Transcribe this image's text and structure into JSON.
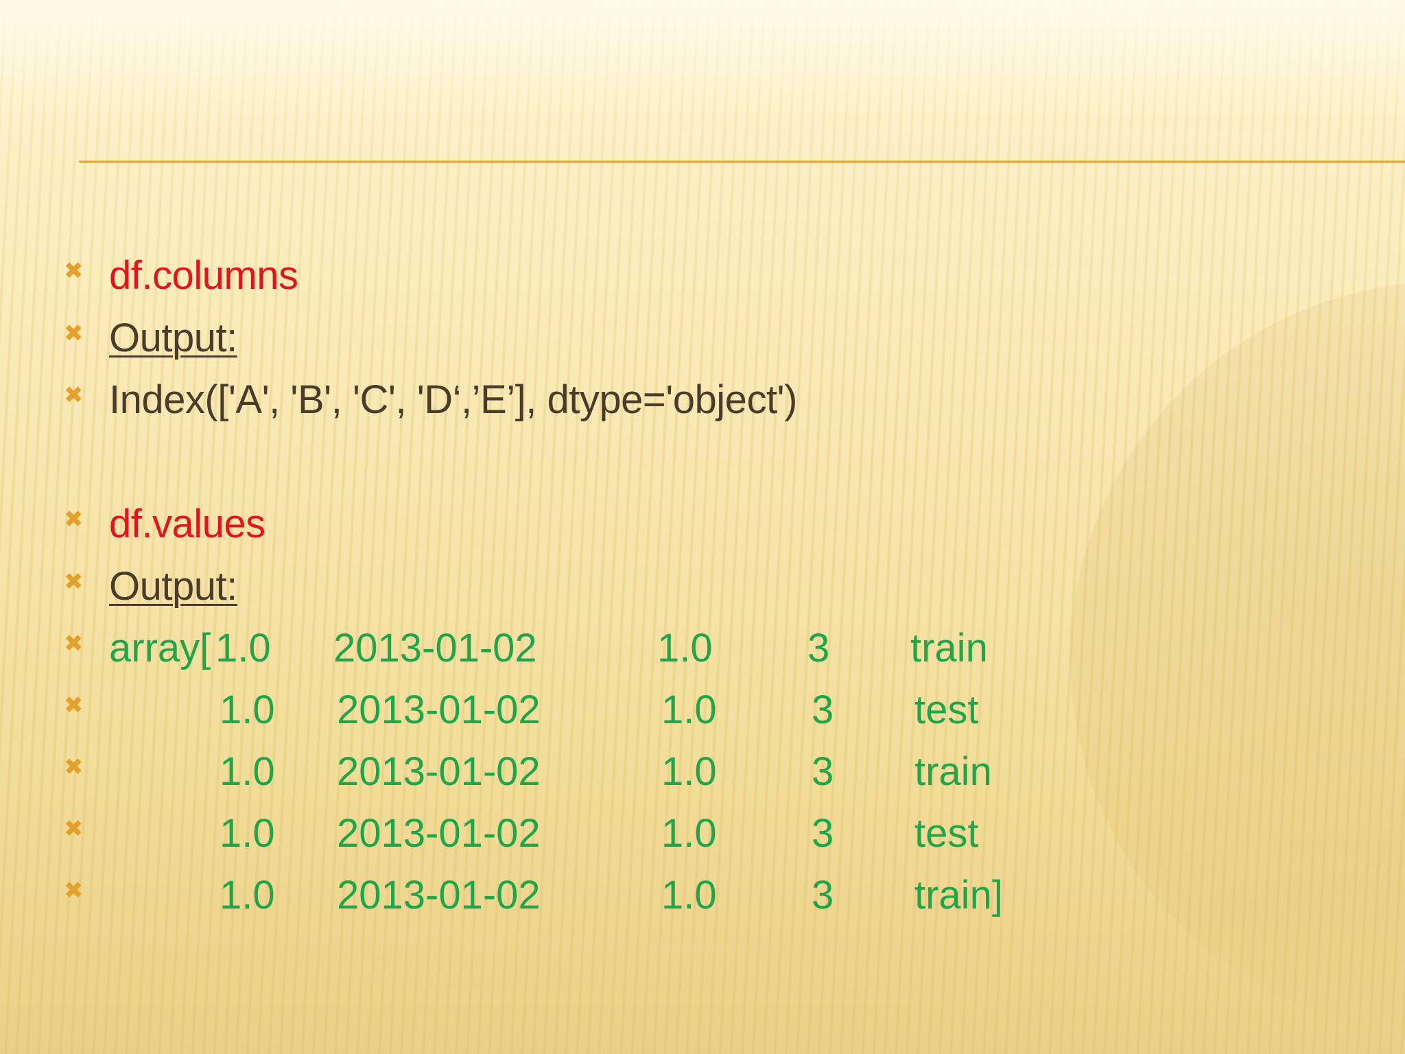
{
  "slide": {
    "colors": {
      "accent_rule": "#e8a33a",
      "marker": "#e3a12c",
      "code_red": "#e5141b",
      "text_dark": "#4a3b2b",
      "output_green": "#1ea64a"
    },
    "marker_icon": "x-mark-icon",
    "bullets": [
      {
        "text": "df.columns"
      },
      {
        "text": "Output:"
      },
      {
        "text": "Index(['A', 'B', 'C', 'D‘,’E’], dtype='object')"
      },
      {
        "text": "df.values"
      },
      {
        "text": "Output:"
      }
    ],
    "array_rows": [
      {
        "prefix": "array[",
        "c1": "1.0",
        "c2": "2013-01-02",
        "c3": "1.0",
        "c4": "3",
        "c5": "train"
      },
      {
        "prefix": "",
        "c1": "1.0",
        "c2": "2013-01-02",
        "c3": "1.0",
        "c4": "3",
        "c5": "test"
      },
      {
        "prefix": "",
        "c1": "1.0",
        "c2": "2013-01-02",
        "c3": "1.0",
        "c4": "3",
        "c5": "train"
      },
      {
        "prefix": "",
        "c1": "1.0",
        "c2": "2013-01-02",
        "c3": "1.0",
        "c4": "3",
        "c5": "test"
      },
      {
        "prefix": "",
        "c1": "1.0",
        "c2": "2013-01-02",
        "c3": "1.0",
        "c4": "3",
        "c5": "train]"
      }
    ]
  }
}
